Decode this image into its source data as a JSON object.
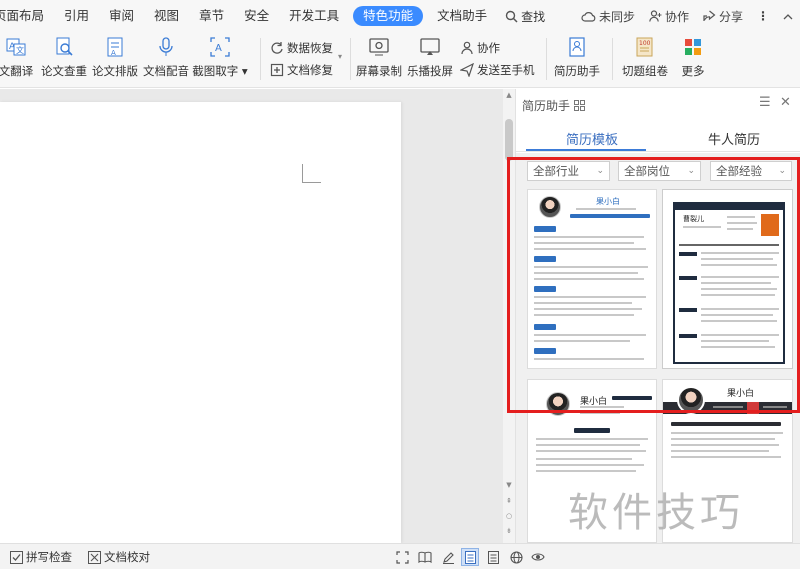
{
  "menu": {
    "items": [
      "页面布局",
      "引用",
      "审阅",
      "视图",
      "章节",
      "安全",
      "开发工具",
      "特色功能",
      "文档助手"
    ],
    "active": "特色功能",
    "search": "查找",
    "right": {
      "sync": "未同步",
      "collab": "协作",
      "share": "分享"
    }
  },
  "ribbon": {
    "translate": "文翻译",
    "paper_check": "论文查重",
    "paper_format": "论文排版",
    "doc_dub": "文档配音",
    "screenshot_ocr": "截图取字",
    "data_recovery": "数据恢复",
    "doc_repair": "文档修复",
    "screen_record": "屏幕录制",
    "cast": "乐播投屏",
    "collab": "协作",
    "send_phone": "发送至手机",
    "resume_helper": "简历助手",
    "split_merge": "切题组卷",
    "more": "更多"
  },
  "pane": {
    "title": "简历助手",
    "tabs": [
      "简历模板",
      "牛人简历"
    ],
    "active_tab": "简历模板",
    "filters": [
      "全部行业",
      "全部岗位",
      "全部经验"
    ],
    "cards": [
      {
        "name": "果小白"
      },
      {
        "name": "曹裂儿"
      },
      {
        "name": "果小白"
      },
      {
        "name": "果小白"
      }
    ]
  },
  "status": {
    "spell": "拼写检查",
    "proof": "文档校对"
  },
  "watermark": "软件技巧",
  "colors": {
    "accent": "#3a8bff",
    "annotation": "#e41e1e",
    "resume_blue": "#2f6fbf"
  }
}
